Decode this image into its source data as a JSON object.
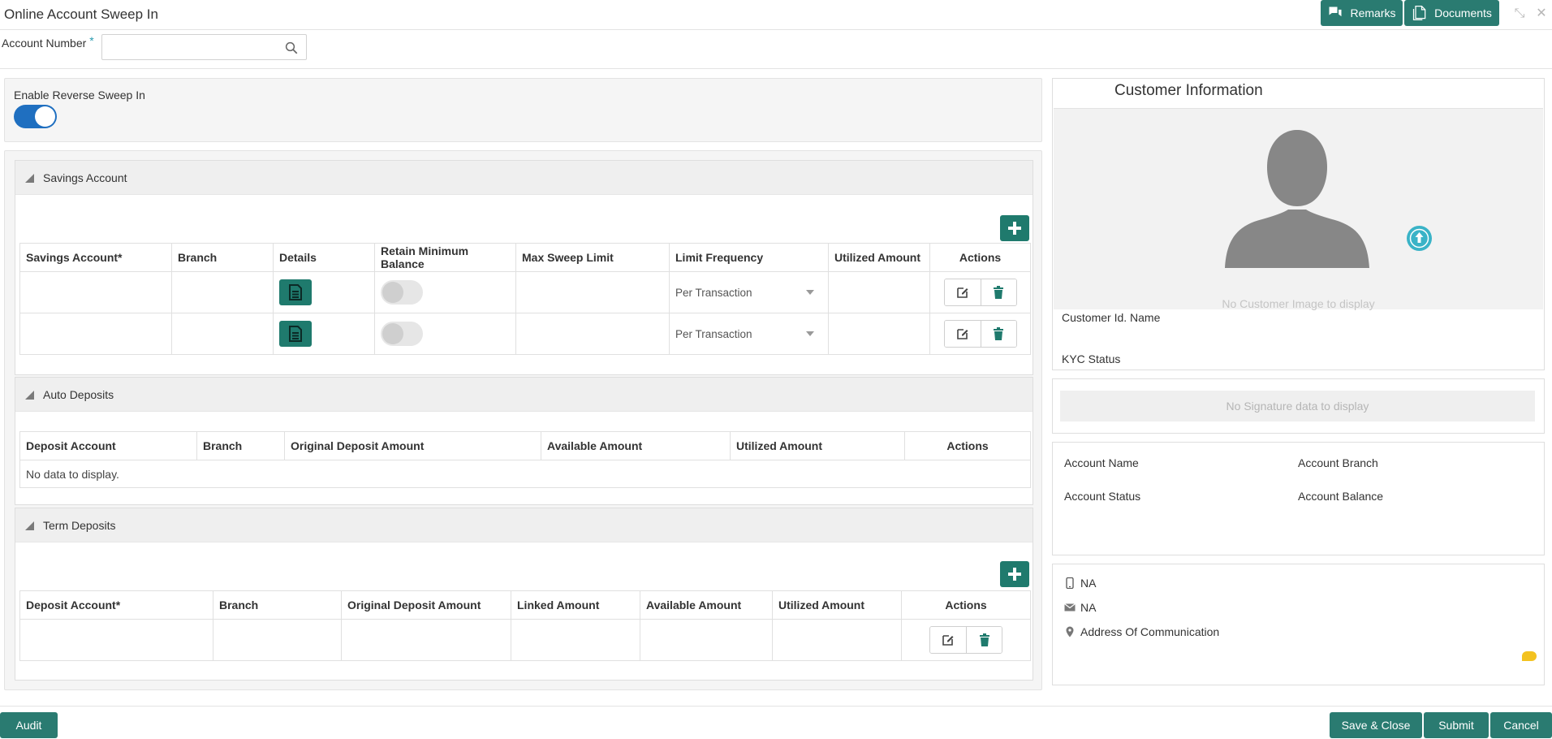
{
  "header": {
    "title": "Online Account Sweep In",
    "remarks_label": "Remarks",
    "documents_label": "Documents"
  },
  "account": {
    "label": "Account Number",
    "required_mark": "*",
    "value": "",
    "placeholder": ""
  },
  "reverse_sweep": {
    "label": "Enable Reverse Sweep In",
    "enabled": true
  },
  "savings": {
    "title": "Savings Account",
    "columns": [
      "Savings Account*",
      "Branch",
      "Details",
      "Retain Minimum Balance",
      "Max Sweep Limit",
      "Limit Frequency",
      "Utilized Amount",
      "Actions"
    ],
    "rows": [
      {
        "account": "",
        "branch": "",
        "retain_min_balance": false,
        "max_sweep_limit": "",
        "limit_frequency": "Per Transaction",
        "utilized_amount": ""
      },
      {
        "account": "",
        "branch": "",
        "retain_min_balance": false,
        "max_sweep_limit": "",
        "limit_frequency": "Per Transaction",
        "utilized_amount": ""
      }
    ]
  },
  "auto_deposits": {
    "title": "Auto Deposits",
    "columns": [
      "Deposit Account",
      "Branch",
      "Original Deposit Amount",
      "Available Amount",
      "Utilized Amount",
      "Actions"
    ],
    "empty_text": "No data to display."
  },
  "term_deposits": {
    "title": "Term Deposits",
    "columns": [
      "Deposit Account*",
      "Branch",
      "Original Deposit Amount",
      "Linked Amount",
      "Available Amount",
      "Utilized Amount",
      "Actions"
    ],
    "rows": [
      {
        "account": "",
        "branch": "",
        "original_amount": "",
        "linked_amount": "",
        "available_amount": "",
        "utilized_amount": ""
      }
    ]
  },
  "customer": {
    "title": "Customer Information",
    "no_image_text": "No Customer Image to display",
    "id_name_label": "Customer Id. Name",
    "kyc_label": "KYC Status",
    "no_signature_text": "No Signature data to display",
    "account_name_label": "Account Name",
    "account_branch_label": "Account Branch",
    "account_status_label": "Account Status",
    "account_balance_label": "Account Balance",
    "phone": "NA",
    "email": "NA",
    "address_label": "Address Of Communication"
  },
  "footer": {
    "audit_label": "Audit",
    "save_close_label": "Save & Close",
    "submit_label": "Submit",
    "cancel_label": "Cancel"
  },
  "colors": {
    "primary": "#2a7b71",
    "toggle_on": "#1f6fc0",
    "upload_accent": "#3ab3c7",
    "chat_accent": "#f3c220"
  },
  "icons": {
    "remarks": "chat-bubbles-icon",
    "documents": "documents-icon",
    "minimize": "compress-icon",
    "close": "close-icon",
    "search": "search-icon",
    "details": "document-icon",
    "edit": "edit-icon",
    "delete": "trash-icon",
    "add": "plus-icon",
    "phone": "mobile-phone-icon",
    "email": "envelope-icon",
    "address": "location-pin-icon"
  }
}
